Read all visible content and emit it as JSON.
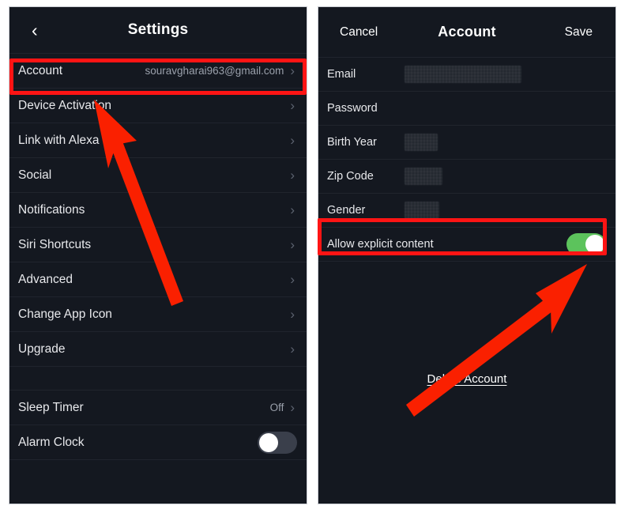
{
  "left_screen": {
    "nav": {
      "back_icon": "chevron-left-icon",
      "title": "Settings"
    },
    "rows": [
      {
        "label": "Account",
        "value": "souravgharai963@gmail.com",
        "accessory": "chevron"
      },
      {
        "label": "Device Activation",
        "value": "",
        "accessory": "chevron"
      },
      {
        "label": "Link with Alexa",
        "value": "",
        "accessory": "chevron"
      },
      {
        "label": "Social",
        "value": "",
        "accessory": "chevron"
      },
      {
        "label": "Notifications",
        "value": "",
        "accessory": "chevron"
      },
      {
        "label": "Siri Shortcuts",
        "value": "",
        "accessory": "chevron"
      },
      {
        "label": "Advanced",
        "value": "",
        "accessory": "chevron"
      },
      {
        "label": "Change App Icon",
        "value": "",
        "accessory": "chevron"
      },
      {
        "label": "Upgrade",
        "value": "",
        "accessory": "chevron"
      }
    ],
    "rows_lower": [
      {
        "label": "Sleep Timer",
        "value": "Off",
        "accessory": "chevron"
      },
      {
        "label": "Alarm Clock",
        "value": "",
        "accessory": "toggle",
        "toggle_on": false
      }
    ]
  },
  "right_screen": {
    "nav": {
      "cancel_label": "Cancel",
      "title": "Account",
      "save_label": "Save"
    },
    "fields": [
      {
        "label": "Email",
        "value": "",
        "redacted": true,
        "redact_width": 148
      },
      {
        "label": "Password",
        "value": "",
        "redacted": false,
        "redact_width": 0
      },
      {
        "label": "Birth Year",
        "value": "",
        "redacted": true,
        "redact_width": 42
      },
      {
        "label": "Zip Code",
        "value": "",
        "redacted": true,
        "redact_width": 48
      },
      {
        "label": "Gender",
        "value": "",
        "redacted": true,
        "redact_width": 44
      }
    ],
    "explicit_row": {
      "label": "Allow explicit content",
      "toggle_on": true
    },
    "delete_link": "Delete Account"
  },
  "annotations": {
    "highlight_color": "#ff1414",
    "arrow_color": "#fa2000",
    "boxes": [
      {
        "name": "account-row-highlight"
      },
      {
        "name": "allow-explicit-content-highlight"
      }
    ],
    "arrows": [
      {
        "name": "arrow-to-account-row"
      },
      {
        "name": "arrow-to-explicit-toggle"
      }
    ]
  },
  "colors": {
    "panel_bg": "#141820",
    "row_divider": "#20242d",
    "label_text": "#e8e9ec",
    "value_text": "#9aa0ab",
    "toggle_on": "#5cc35c",
    "toggle_off": "#3a3f4b"
  }
}
